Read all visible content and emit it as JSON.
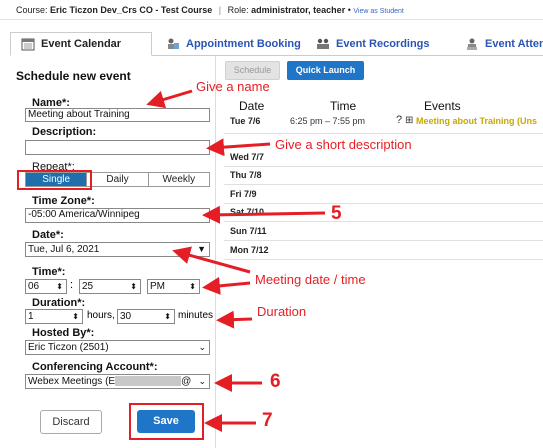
{
  "topbar": {
    "course_label": "Course:",
    "course_name": "Eric Ticzon Dev_Crs CO - Test Course",
    "role_label": "Role:",
    "role_value": "administrator, teacher",
    "bullet": "•",
    "view_as": "View as Student"
  },
  "tabs": [
    {
      "label": "Event Calendar"
    },
    {
      "label": "Appointment Booking"
    },
    {
      "label": "Event Recordings"
    },
    {
      "label": "Event Atten"
    }
  ],
  "form": {
    "title": "Schedule new event",
    "name_label": "Name*:",
    "name_value": "Meeting about Training",
    "description_label": "Description:",
    "description_value": "",
    "repeat_label": "Repeat*:",
    "repeat_options": [
      "Single",
      "Daily",
      "Weekly"
    ],
    "timezone_label": "Time Zone*:",
    "timezone_value": "-05:00 America/Winnipeg",
    "date_label": "Date*:",
    "date_value": "Tue, Jul 6, 2021",
    "time_label": "Time*:",
    "time_hour": "06",
    "time_colon": ":",
    "time_minute": "25",
    "time_ampm": "PM",
    "duration_label": "Duration*:",
    "duration_hours": "1",
    "hours_text": "hours,",
    "duration_minutes": "30",
    "minutes_text": "minutes",
    "hosted_label": "Hosted By*:",
    "hosted_value": "Eric Ticzon (2501)",
    "conf_label": "Conferencing Account*:",
    "conf_value_prefix": "Webex Meetings (E",
    "conf_value_suffix": "@",
    "discard_label": "Discard",
    "save_label": "Save"
  },
  "calendar": {
    "schedule_btn": "Schedule",
    "quicklaunch_btn": "Quick Launch",
    "col_date": "Date",
    "col_time": "Time",
    "col_events": "Events",
    "rows": [
      {
        "date": "Tue 7/6",
        "time": "6:25 pm – 7:55 pm",
        "event": "Meeting about Training (Uns"
      },
      {
        "date": "Wed 7/7"
      },
      {
        "date": "Thu 7/8"
      },
      {
        "date": "Fri 7/9"
      },
      {
        "date": "Sat 7/10"
      },
      {
        "date": "Sun 7/11"
      },
      {
        "date": "Mon 7/12"
      }
    ],
    "help_glyph": "?",
    "expand_glyph": "⊞"
  },
  "annotations": {
    "give_name": "Give a name",
    "give_description": "Give a short description",
    "step5": "5",
    "meeting_datetime": "Meeting date / time",
    "duration": "Duration",
    "step6": "6",
    "step7": "7"
  },
  "colors": {
    "accent_blue": "#1f76c8",
    "annotation_red": "#e51e25",
    "selected_repeat": "#1f6fad",
    "event_text": "#c8a800"
  },
  "icons": [
    "calendar-icon",
    "appointment-icon",
    "recordings-icon",
    "attendance-icon",
    "help-icon",
    "expand-icon"
  ]
}
